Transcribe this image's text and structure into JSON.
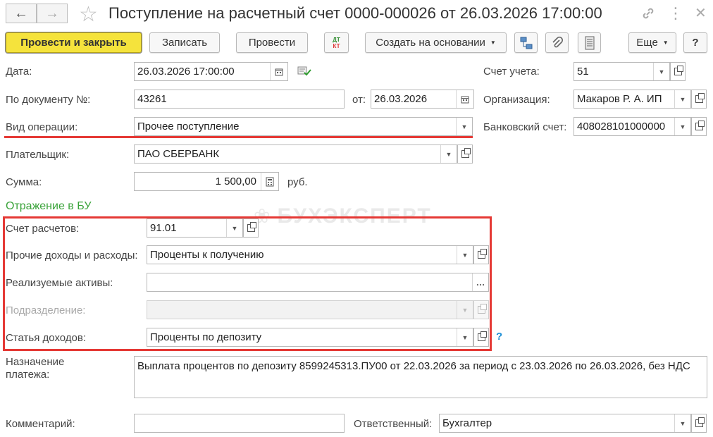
{
  "window": {
    "title": "Поступление на расчетный счет 0000-000026 от 26.03.2026 17:00:00"
  },
  "toolbar": {
    "post_close": "Провести и закрыть",
    "save": "Записать",
    "post": "Провести",
    "dtkt_dt": "ДТ",
    "dtkt_kt": "КТ",
    "create_based": "Создать на основании",
    "more": "Еще",
    "help": "?"
  },
  "form": {
    "date_label": "Дата:",
    "date_value": "26.03.2026 17:00:00",
    "docnum_label": "По документу №:",
    "docnum_value": "43261",
    "from_label": "от:",
    "from_value": "26.03.2026",
    "optype_label": "Вид операции:",
    "optype_value": "Прочее поступление",
    "payer_label": "Плательщик:",
    "payer_value": "ПАО СБЕРБАНК",
    "sum_label": "Сумма:",
    "sum_value": "1 500,00",
    "currency": "руб.",
    "account_label": "Счет учета:",
    "account_value": "51",
    "org_label": "Организация:",
    "org_value": "Макаров Р. А. ИП",
    "bank_label": "Банковский счет:",
    "bank_value": "408028101000000"
  },
  "bu": {
    "section_title": "Отражение в БУ",
    "watermark": "БУХЭКСПЕРТ",
    "settle_label": "Счет расчетов:",
    "settle_value": "91.01",
    "other_label": "Прочие доходы и расходы:",
    "other_value": "Проценты к получению",
    "assets_label": "Реализуемые активы:",
    "assets_value": "",
    "dept_label": "Подразделение:",
    "dept_value": "",
    "income_label": "Статья доходов:",
    "income_value": "Проценты по депозиту",
    "help_mark": "?"
  },
  "bottom": {
    "purpose_label_1": "Назначение",
    "purpose_label_2": "платежа:",
    "purpose_value": "Выплата процентов по депозиту 8599245313.ПУ00 от 22.03.2026 за период с 23.03.2026 по 26.03.2026, без НДС",
    "comment_label": "Комментарий:",
    "comment_value": "",
    "resp_label": "Ответственный:",
    "resp_value": "Бухгалтер"
  },
  "colors": {
    "primary_button": "#f5e33c",
    "highlight": "#e53935",
    "section_green": "#3aa33a",
    "help_blue": "#1c8fd6"
  }
}
